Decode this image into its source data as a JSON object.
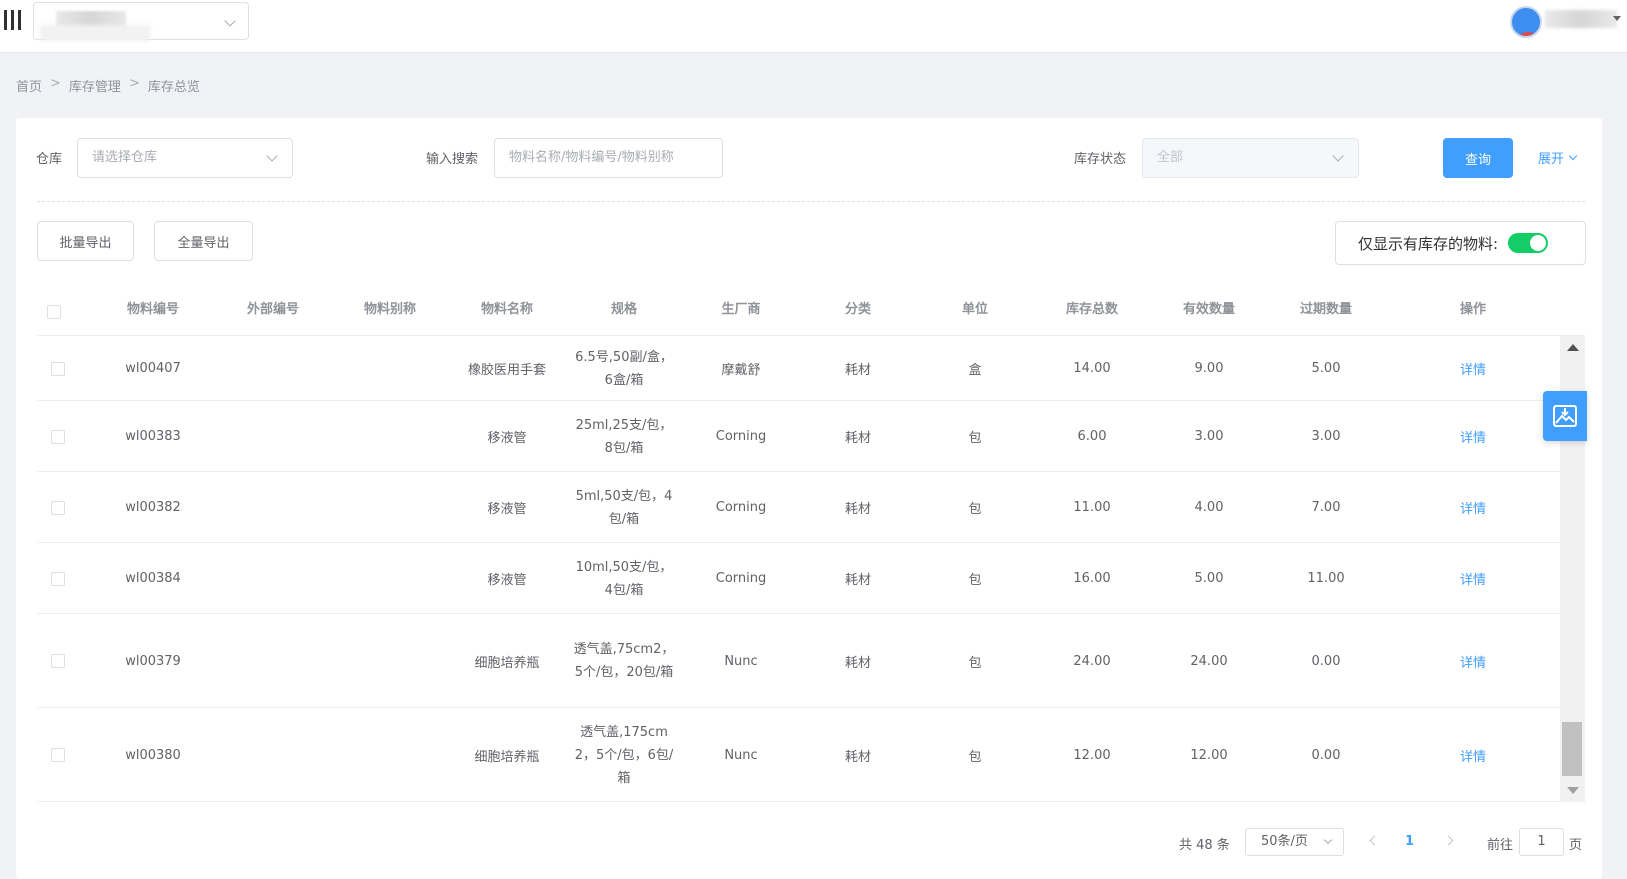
{
  "breadcrumb": [
    "首页",
    "库存管理",
    "库存总览"
  ],
  "breadcrumb_sep": ">",
  "filters": {
    "warehouse": {
      "label": "仓库",
      "placeholder": "请选择仓库"
    },
    "search": {
      "label": "输入搜索",
      "placeholder": "物料名称/物料编号/物料别称"
    },
    "status": {
      "label": "库存状态",
      "value": "全部"
    },
    "query_label": "查询",
    "expand_label": "展开"
  },
  "actions": {
    "batch_export": "批量导出",
    "full_export": "全量导出",
    "only_in_stock_label": "仅显示有库存的物料:",
    "only_in_stock_on": true
  },
  "table": {
    "columns": [
      "物料编号",
      "外部编号",
      "物料别称",
      "物料名称",
      "规格",
      "生厂商",
      "分类",
      "单位",
      "库存总数",
      "有效数量",
      "过期数量",
      "操作"
    ],
    "rows": [
      {
        "code": "wl00407",
        "external": "",
        "alias": "",
        "name": "橡胶医用手套",
        "spec": "6.5号,50副/盒，6盒/箱",
        "maker": "摩戴舒",
        "category": "耗材",
        "unit": "盒",
        "total": "14.00",
        "valid": "9.00",
        "expired": "5.00",
        "action": "详情"
      },
      {
        "code": "wl00383",
        "external": "",
        "alias": "",
        "name": "移液管",
        "spec": "25ml,25支/包，8包/箱",
        "maker": "Corning",
        "category": "耗材",
        "unit": "包",
        "total": "6.00",
        "valid": "3.00",
        "expired": "3.00",
        "action": "详情"
      },
      {
        "code": "wl00382",
        "external": "",
        "alias": "",
        "name": "移液管",
        "spec": "5ml,50支/包，4包/箱",
        "maker": "Corning",
        "category": "耗材",
        "unit": "包",
        "total": "11.00",
        "valid": "4.00",
        "expired": "7.00",
        "action": "详情"
      },
      {
        "code": "wl00384",
        "external": "",
        "alias": "",
        "name": "移液管",
        "spec": "10ml,50支/包，4包/箱",
        "maker": "Corning",
        "category": "耗材",
        "unit": "包",
        "total": "16.00",
        "valid": "5.00",
        "expired": "11.00",
        "action": "详情"
      },
      {
        "code": "wl00379",
        "external": "",
        "alias": "",
        "name": "细胞培养瓶",
        "spec": "透气盖,75cm2，5个/包，20包/箱",
        "maker": "Nunc",
        "category": "耗材",
        "unit": "包",
        "total": "24.00",
        "valid": "24.00",
        "expired": "0.00",
        "action": "详情"
      },
      {
        "code": "wl00380",
        "external": "",
        "alias": "",
        "name": "细胞培养瓶",
        "spec": "透气盖,175cm2，5个/包，6包/箱",
        "maker": "Nunc",
        "category": "耗材",
        "unit": "包",
        "total": "12.00",
        "valid": "12.00",
        "expired": "0.00",
        "action": "详情"
      }
    ]
  },
  "pagination": {
    "total_label": "共 48 条",
    "page_size": "50条/页",
    "current_page": "1",
    "goto_label": "前往",
    "goto_value": "1",
    "page_suffix": "页"
  },
  "icons": {
    "menu": "hamburger-icon",
    "float": "image-download-icon"
  },
  "colors": {
    "primary": "#409eff",
    "switch_on": "#13ce66"
  }
}
